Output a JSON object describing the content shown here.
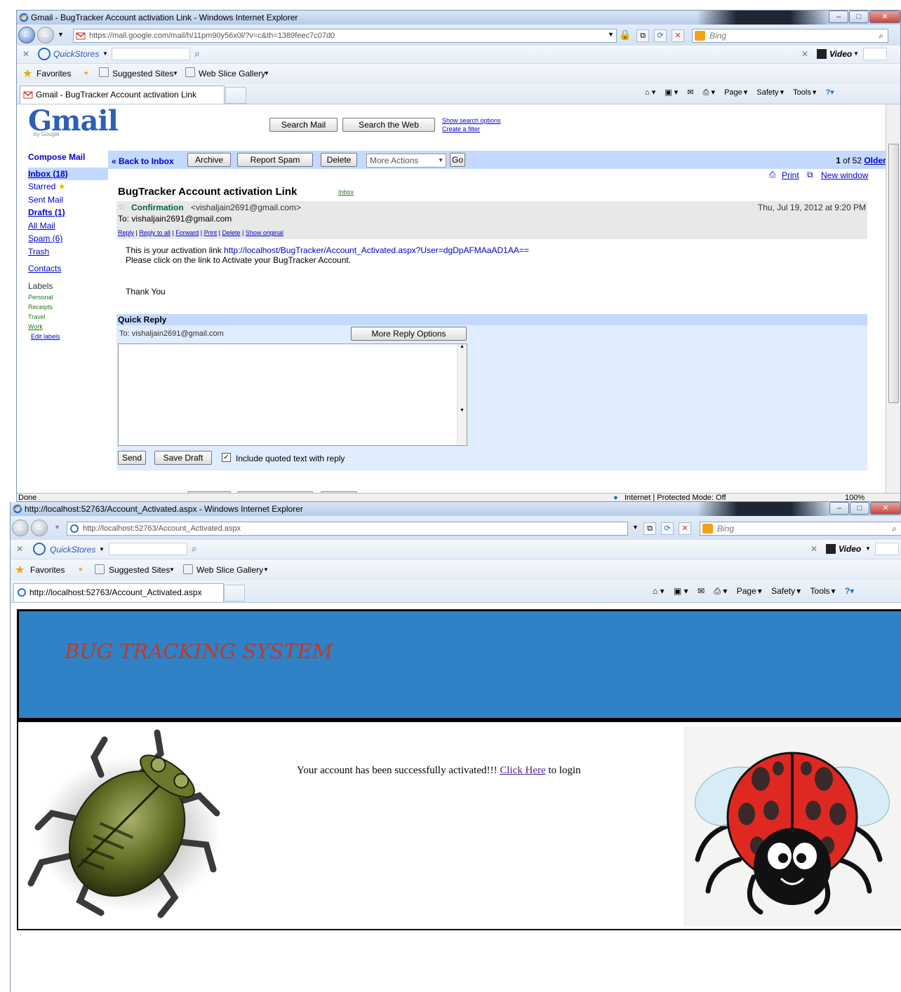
{
  "ie1": {
    "title": "Gmail - BugTracker Account activation Link - Windows Internet Explorer",
    "url": "https://mail.google.com/mail/h/11pm90y56x0l/?v=c&th=1389feec7c07d0",
    "search_provider": "Bing",
    "quickstores": "QuickStores",
    "video_label": "Video",
    "favorites_label": "Favorites",
    "suggested_sites": "Suggested Sites",
    "web_slice_gallery": "Web Slice Gallery",
    "tab_title": "Gmail - BugTracker Account activation Link",
    "cmd": {
      "page": "Page",
      "safety": "Safety",
      "tools": "Tools"
    },
    "status_left": "Done",
    "status_zone": "Internet | Protected Mode: Off",
    "zoom": "100%"
  },
  "gmail": {
    "logo_text": "Gmail",
    "logo_by": "by Google",
    "search_mail": "Search Mail",
    "search_web": "Search the Web",
    "show_search_options": "Show search options",
    "create_filter": "Create a filter",
    "nav": {
      "compose": "Compose Mail",
      "inbox": "Inbox (18)",
      "starred": "Starred",
      "sent": "Sent Mail",
      "drafts": "Drafts (1)",
      "all": "All Mail",
      "spam": "Spam (6)",
      "trash": "Trash",
      "contacts": "Contacts",
      "labels_heading": "Labels",
      "labels": [
        "Personal",
        "Receipts",
        "Travel",
        "Work"
      ],
      "edit_labels": "Edit labels"
    },
    "toolbar": {
      "back": "« Back to Inbox",
      "archive": "Archive",
      "report_spam": "Report Spam",
      "delete": "Delete",
      "more_actions": "More Actions",
      "go": "Go",
      "count_pre": "1",
      "count_of": "of 52",
      "older": "Older ›",
      "print": "Print",
      "new_window": "New window"
    },
    "message": {
      "subject": "BugTracker Account activation Link",
      "label": "Inbox",
      "from_name": "Confirmation",
      "from_email": "<vishaljain2691@gmail.com>",
      "date": "Thu, Jul 19, 2012 at 9:20 PM",
      "to": "To: vishaljain2691@gmail.com",
      "actions": [
        "Reply",
        "Reply to all",
        "Forward",
        "Print",
        "Delete",
        "Show original"
      ],
      "body_line1_prefix": "This is your activation link ",
      "body_link": "http://localhost/BugTracker/Account_Activated.aspx?User=dgDpAFMAaAD1AA==",
      "body_line2": "Please click on the link to Activate your BugTracker Account.",
      "body_line3": "Thank You"
    },
    "quick_reply": {
      "heading": "Quick Reply",
      "to": "To: vishaljain2691@gmail.com",
      "more_options": "More Reply Options",
      "send": "Send",
      "save_draft": "Save Draft",
      "include_quoted": "Include quoted text with reply"
    }
  },
  "ie2": {
    "title": "http://localhost:52763/Account_Activated.aspx - Windows Internet Explorer",
    "url": "http://localhost:52763/Account_Activated.aspx",
    "search_provider": "Bing",
    "quickstores": "QuickStores",
    "video_label": "Video",
    "favorites_label": "Favorites",
    "suggested_sites": "Suggested Sites",
    "web_slice_gallery": "Web Slice Gallery",
    "tab_title": "http://localhost:52763/Account_Activated.aspx",
    "cmd": {
      "page": "Page",
      "safety": "Safety",
      "tools": "Tools"
    }
  },
  "bts": {
    "title": "BUG TRACKING SYSTEM",
    "message_pre": "Your account has been successfully activated!!! ",
    "click_here": "Click Here",
    "message_post": " to login",
    "colors": {
      "header_bg": "#2f82c5",
      "title": "#c0392b"
    }
  }
}
